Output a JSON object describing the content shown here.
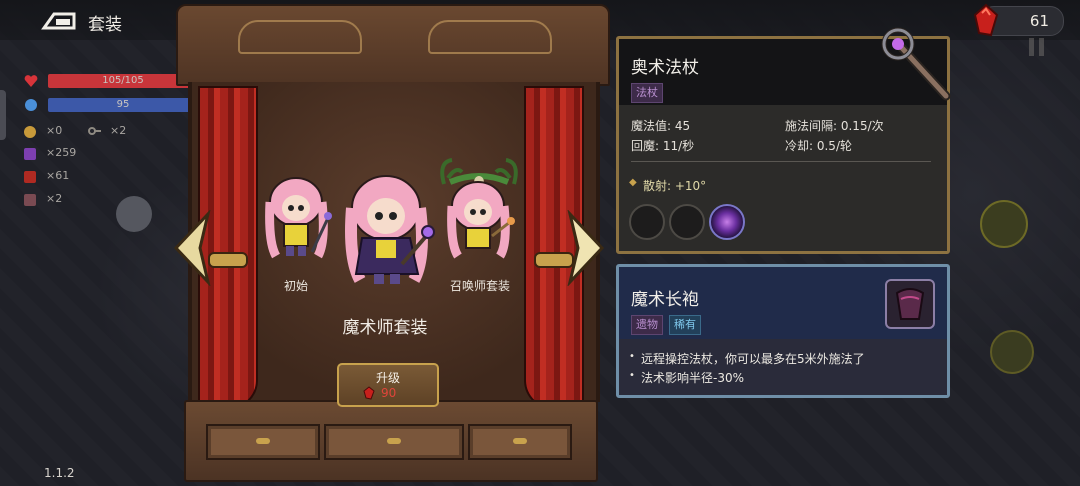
{
  "header": {
    "title": "套装",
    "gems": "61"
  },
  "hud": {
    "hp": "105/105",
    "mana": "95",
    "coins": "×0",
    "keys": "×2",
    "crystals": "×259",
    "gems": "×61",
    "other": "×2"
  },
  "version": "1.1.2",
  "stage": {
    "characters": [
      {
        "label": "初始"
      },
      {
        "label": ""
      },
      {
        "label": "召唤师套装"
      }
    ],
    "costume_name": "魔术师套装",
    "upgrade": {
      "label": "升级",
      "cost": "90"
    }
  },
  "weapon": {
    "name": "奥术法杖",
    "tag": "法杖",
    "stats": {
      "mana": "魔法值: 45",
      "interval": "施法间隔: 0.15/次",
      "regen": "回魔: 11/秒",
      "cooldown": "冷却: 0.5/轮"
    },
    "scatter": "散射: +10°"
  },
  "item": {
    "name": "魔术长袍",
    "tag_type": "遗物",
    "tag_rarity": "稀有",
    "effects": [
      "远程操控法杖，你可以最多在5米外施法了",
      "法术影响半径-30%"
    ]
  },
  "colors": {
    "hp_bar": "#c8353a",
    "mana_bar": "#3c58a8",
    "frame_gold": "#8d7241",
    "relic_blue": "#6f8fa8",
    "rare_tag": "#4aa7d6"
  }
}
